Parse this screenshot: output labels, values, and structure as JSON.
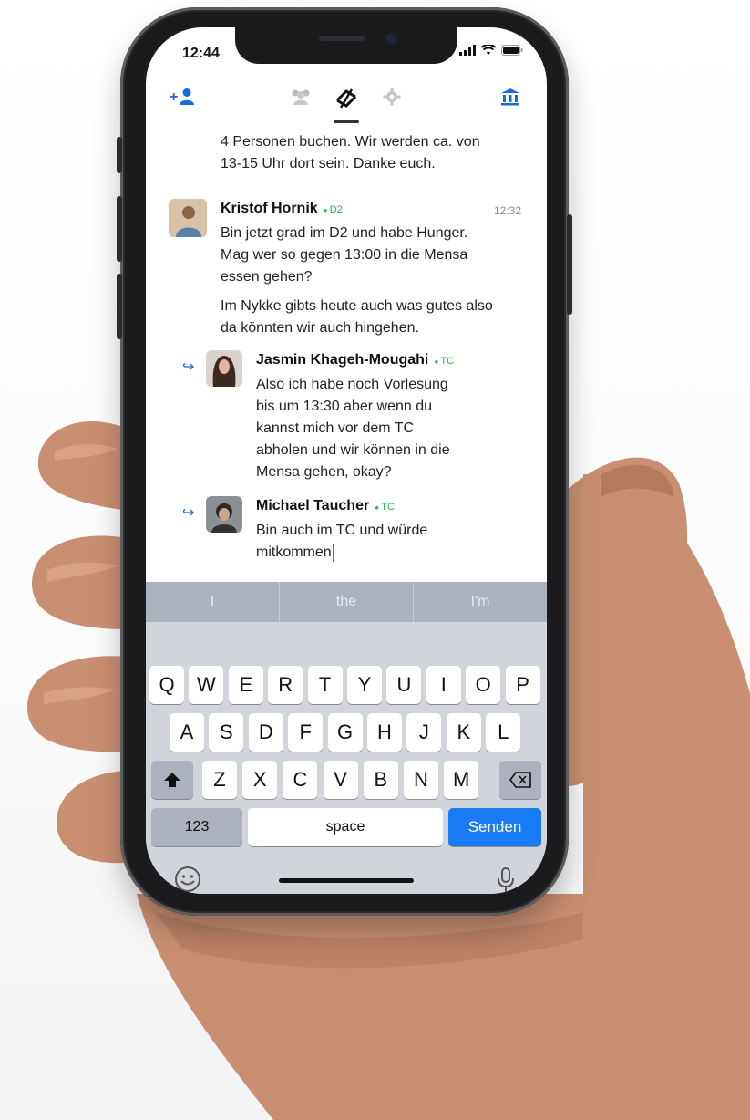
{
  "status": {
    "time": "12:44"
  },
  "nav": {
    "left_icon": "add-person-icon",
    "center_icons": [
      "group-icon",
      "rotate-link-icon",
      "settings-gear-icon"
    ],
    "right_icon": "institution-icon",
    "accent": "#1a6ad8"
  },
  "chat": {
    "prev_lines": [
      "4 Personen buchen. Wir werden ca. von",
      "13-15 Uhr dort sein. Danke euch."
    ],
    "messages": [
      {
        "name": "Kristof Hornik",
        "tag": "D2",
        "time": "12:32",
        "lines": [
          "Bin jetzt grad im D2 und habe Hunger.",
          "Mag wer so gegen 13:00 in die Mensa",
          "essen gehen?"
        ],
        "lines2": [
          "Im Nykke gibts heute auch was gutes also",
          "da könnten wir auch hingehen."
        ]
      },
      {
        "name": "Jasmin Khageh-Mougahi",
        "tag": "TC",
        "lines": [
          "Also ich habe noch Vorlesung",
          "bis um 13:30 aber wenn du",
          "kannst mich vor dem TC",
          "abholen und wir können in die",
          "Mensa gehen, okay?"
        ]
      },
      {
        "name": "Michael Taucher",
        "tag": "TC",
        "lines": [
          "Bin auch im TC und würde",
          "mitkommen"
        ]
      }
    ]
  },
  "keyboard": {
    "suggestions": [
      "I",
      "the",
      "I'm"
    ],
    "row1": [
      "Q",
      "W",
      "E",
      "R",
      "T",
      "Y",
      "U",
      "I",
      "O",
      "P"
    ],
    "row2": [
      "A",
      "S",
      "D",
      "F",
      "G",
      "H",
      "J",
      "K",
      "L"
    ],
    "row3": [
      "Z",
      "X",
      "C",
      "V",
      "B",
      "N",
      "M"
    ],
    "numbers": "123",
    "space": "space",
    "send": "Senden"
  },
  "colors": {
    "tag_green": "#2bb24c",
    "send_blue": "#1a7cf5"
  }
}
